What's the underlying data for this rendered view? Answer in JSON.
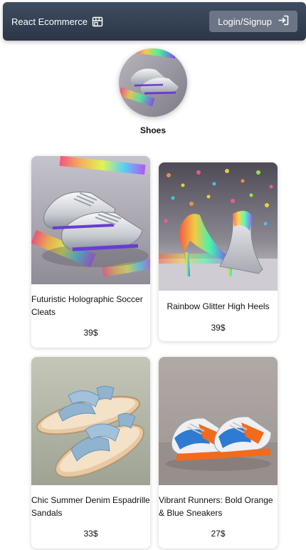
{
  "navbar": {
    "brand": "React Ecommerce",
    "brand_icon": "store-icon",
    "login_label": "Login/Signup",
    "login_icon": "sign-in-icon"
  },
  "category": {
    "title": "Shoes"
  },
  "products": [
    {
      "name": "Futuristic Holographic Soccer Cleats",
      "price": "39$"
    },
    {
      "name": "Rainbow Glitter High Heels",
      "price": "39$"
    },
    {
      "name": "Chic Summer Denim Espadrille Sandals",
      "price": "33$"
    },
    {
      "name": "Vibrant Runners: Bold Orange & Blue Sneakers",
      "price": "27$"
    }
  ],
  "colors": {
    "navbar": "#2f3a4c",
    "login_button": "#6b7585"
  }
}
